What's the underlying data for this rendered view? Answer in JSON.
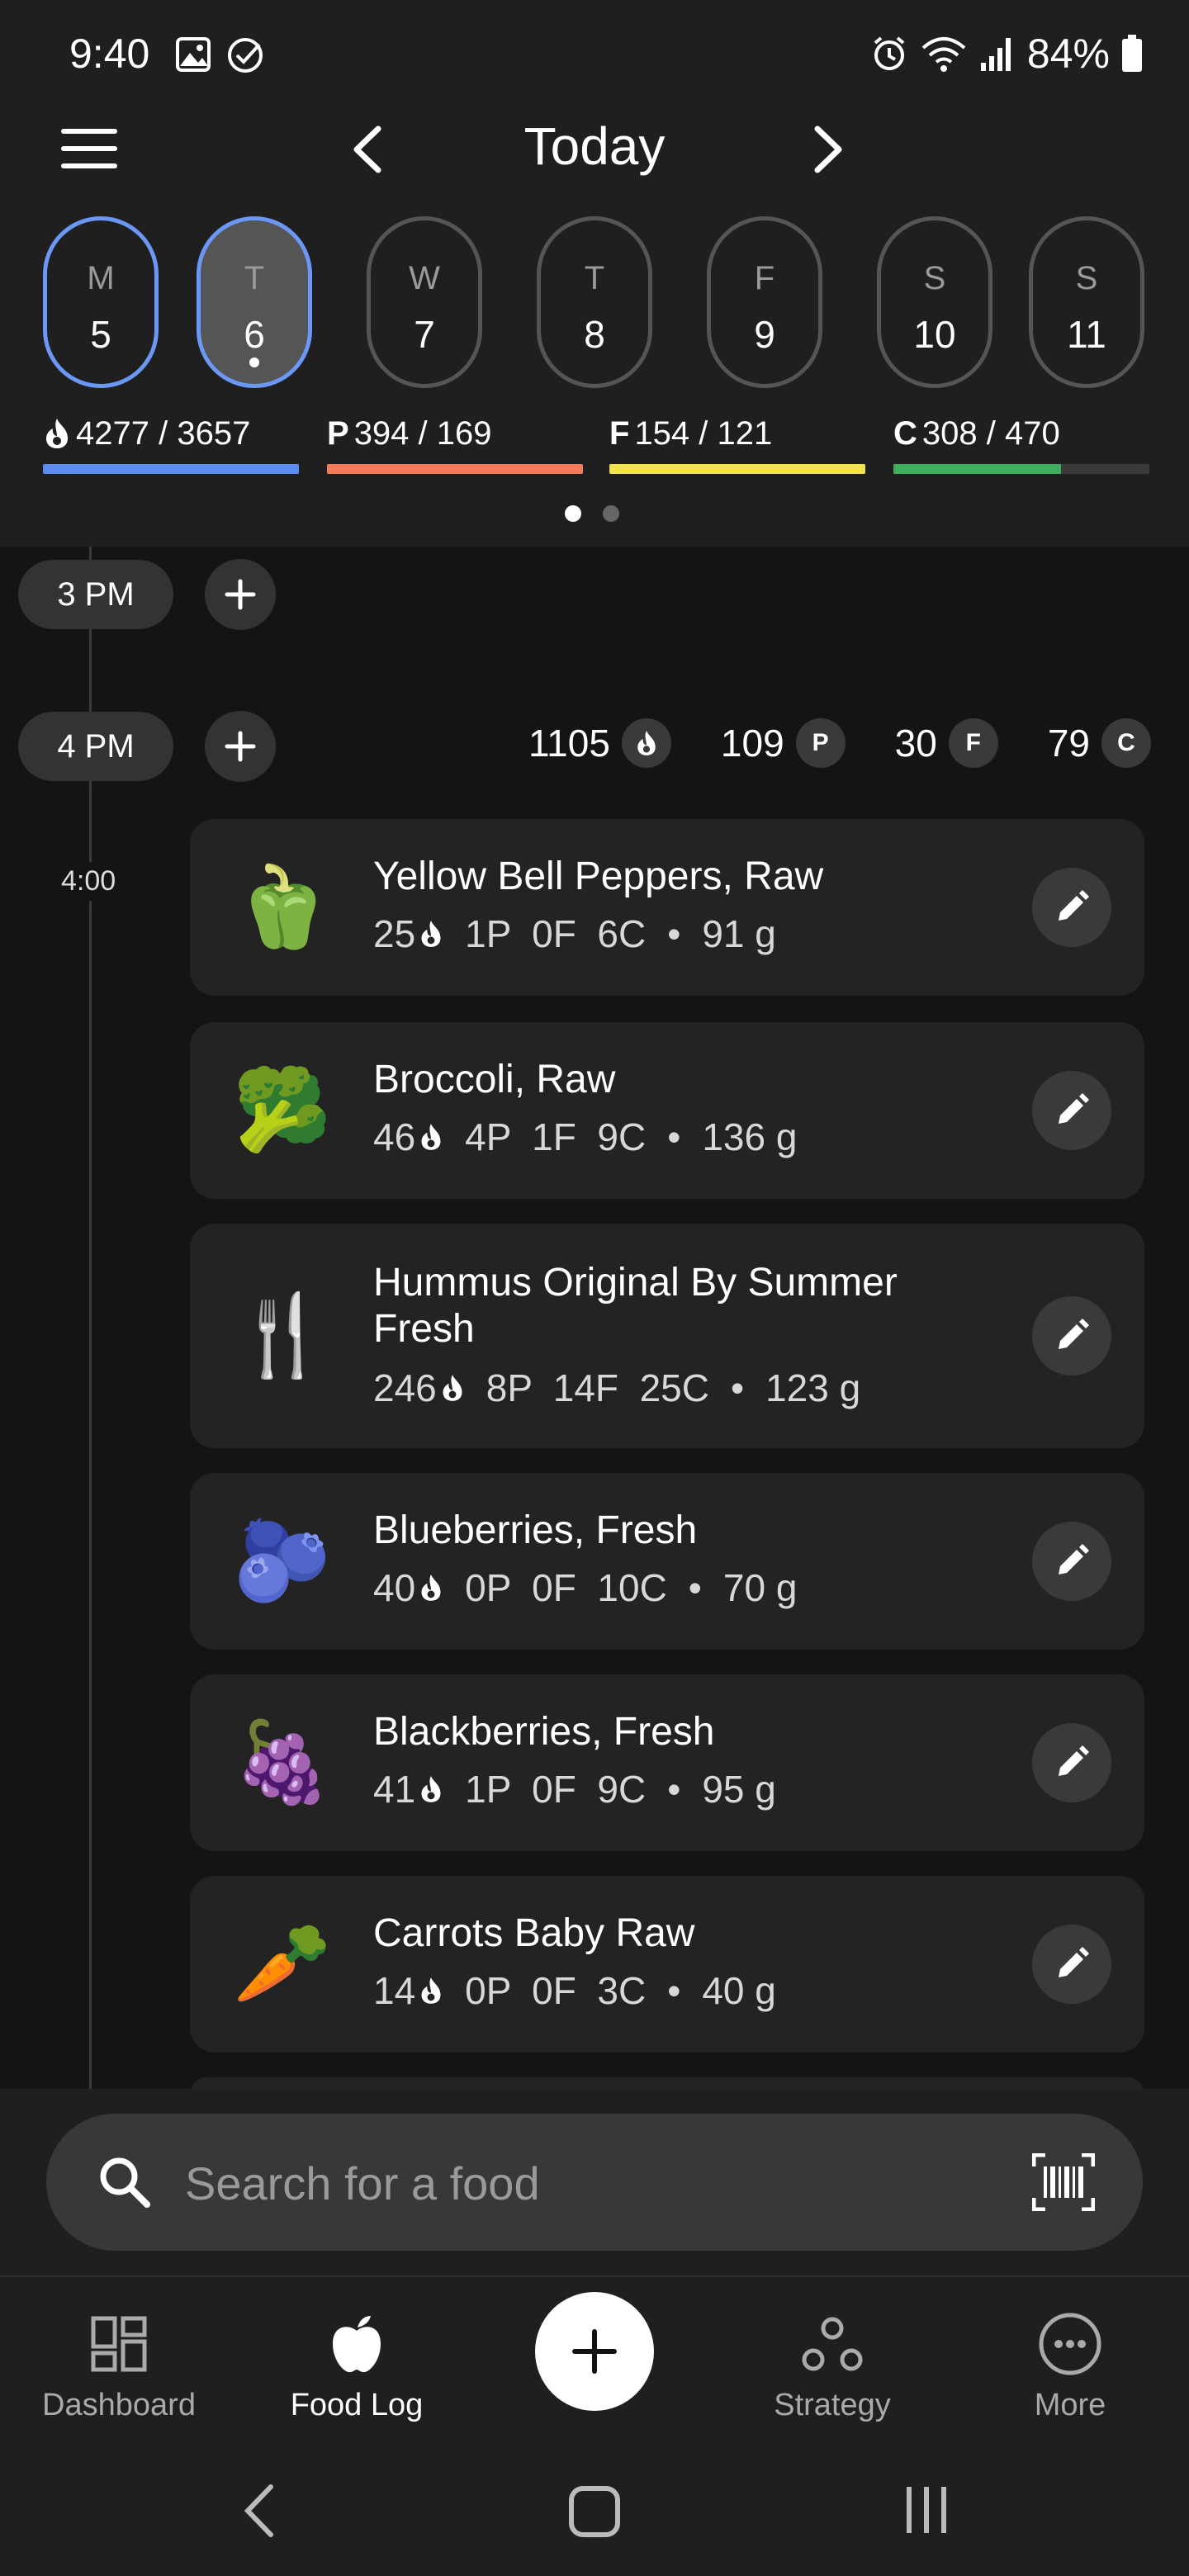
{
  "status_bar": {
    "time": "9:40",
    "battery": "84%"
  },
  "header": {
    "title": "Today"
  },
  "week": [
    {
      "letter": "M",
      "num": "5"
    },
    {
      "letter": "T",
      "num": "6"
    },
    {
      "letter": "W",
      "num": "7"
    },
    {
      "letter": "T",
      "num": "8"
    },
    {
      "letter": "F",
      "num": "9"
    },
    {
      "letter": "S",
      "num": "10"
    },
    {
      "letter": "S",
      "num": "11"
    }
  ],
  "macros": {
    "calories": {
      "value": "4277 / 3657",
      "progress": 1.0,
      "color": "#5b8def"
    },
    "protein": {
      "prefix": "P",
      "value": "394 / 169",
      "progress": 1.0,
      "color": "#f47c5b"
    },
    "fat": {
      "prefix": "F",
      "value": "154 / 121",
      "progress": 1.0,
      "color": "#f2e44a"
    },
    "carbs": {
      "prefix": "C",
      "value": "308 / 470",
      "progress": 0.655,
      "color": "#3fae5f"
    }
  },
  "timeline": {
    "hour1": "3 PM",
    "hour2": "4 PM",
    "totals": {
      "cal": "1105",
      "p": "109",
      "f": "30",
      "c": "79"
    },
    "p_badge": "P",
    "f_badge": "F",
    "c_badge": "C",
    "time_mark": "4:00"
  },
  "foods": [
    {
      "name": "Yellow Bell Peppers, Raw",
      "emoji": "🫑",
      "cal": "25",
      "macros": "1P  0F  6C",
      "weight": "91 g"
    },
    {
      "name": "Broccoli, Raw",
      "emoji": "🥦",
      "cal": "46",
      "macros": "4P  1F  9C",
      "weight": "136 g"
    },
    {
      "name": "Hummus Original By Summer Fresh",
      "emoji": "🍴",
      "cal": "246",
      "macros": "8P  14F  25C",
      "weight": "123 g"
    },
    {
      "name": "Blueberries, Fresh",
      "emoji": "🫐",
      "cal": "40",
      "macros": "0P  0F  10C",
      "weight": "70 g"
    },
    {
      "name": "Blackberries, Fresh",
      "emoji": "🍇",
      "cal": "41",
      "macros": "1P  0F  9C",
      "weight": "95 g"
    },
    {
      "name": "Carrots Baby Raw",
      "emoji": "🥕",
      "cal": "14",
      "macros": "0P  0F  3C",
      "weight": "40 g"
    }
  ],
  "search": {
    "placeholder": "Search for a food"
  },
  "nav": {
    "dashboard": "Dashboard",
    "food_log": "Food Log",
    "strategy": "Strategy",
    "more": "More"
  },
  "separator": "•"
}
